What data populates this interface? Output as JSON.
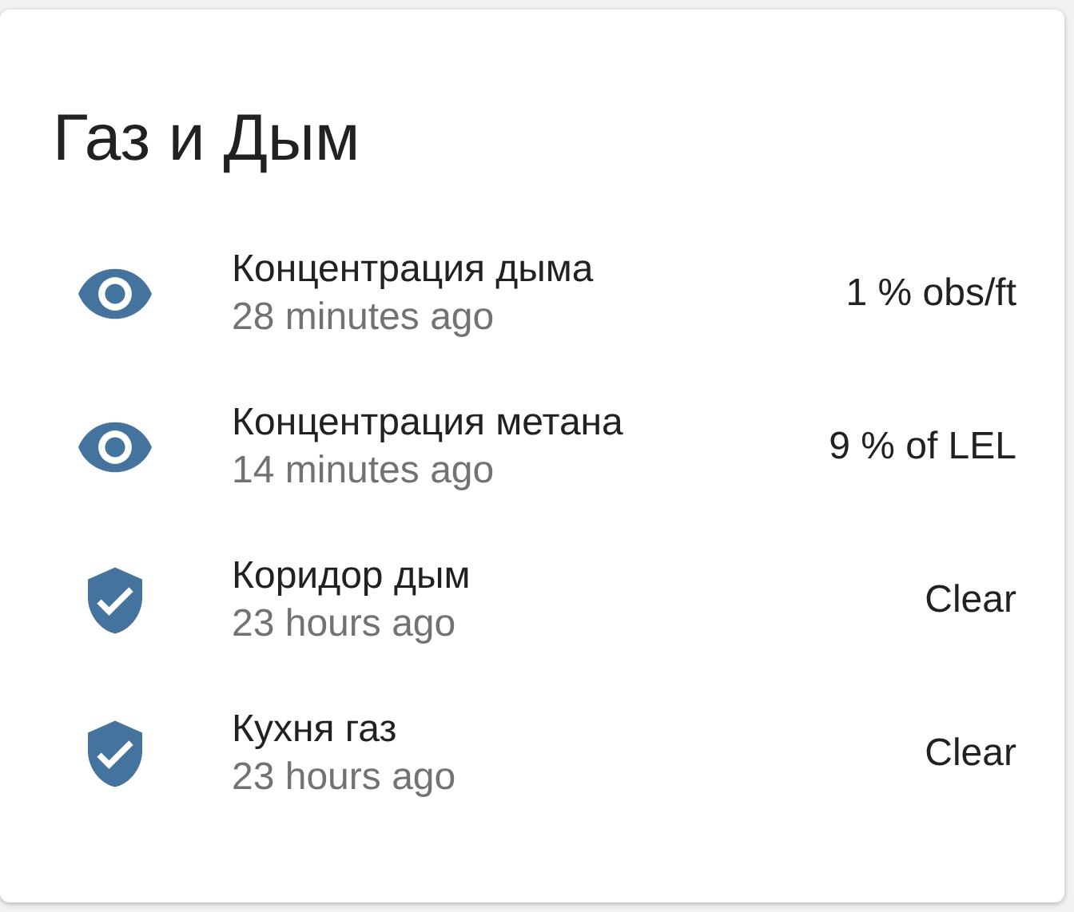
{
  "card": {
    "title": "Газ и Дым",
    "entities": [
      {
        "kind": "eye",
        "name": "Концентрация дыма",
        "updated": "28 minutes ago",
        "state": "1 % obs/ft"
      },
      {
        "kind": "eye",
        "name": "Концентрация метана",
        "updated": "14 minutes ago",
        "state": "9 % of LEL"
      },
      {
        "kind": "shield",
        "name": "Коридор дым",
        "updated": "23 hours ago",
        "state": "Clear"
      },
      {
        "kind": "shield",
        "name": "Кухня газ",
        "updated": "23 hours ago",
        "state": "Clear"
      }
    ]
  }
}
